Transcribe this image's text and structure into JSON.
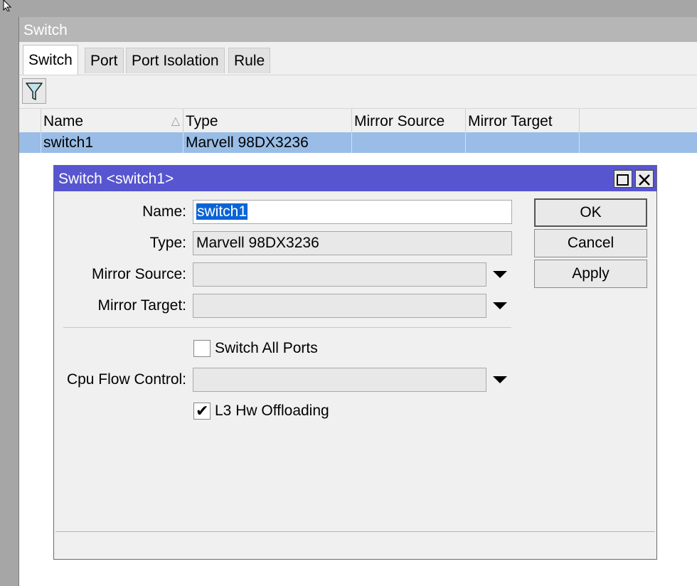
{
  "window": {
    "title": "Switch"
  },
  "tabs": [
    "Switch",
    "Port",
    "Port Isolation",
    "Rule"
  ],
  "icons": {
    "filter": "filter-icon",
    "cursor": "arrow-cursor-icon",
    "maximize": "maximize-icon",
    "close": "close-icon",
    "dropdown": "chevron-down-icon",
    "sort": "sort-ascending-icon"
  },
  "table": {
    "columns": [
      "Name",
      "Type",
      "Mirror Source",
      "Mirror Target"
    ],
    "rows": [
      {
        "name": "switch1",
        "type": "Marvell 98DX3236",
        "mirror_source": "",
        "mirror_target": ""
      }
    ]
  },
  "dialog": {
    "title": "Switch <switch1>",
    "name_label": "Name:",
    "name_value": "switch1",
    "type_label": "Type:",
    "type_value": "Marvell 98DX3236",
    "mirror_source_label": "Mirror Source:",
    "mirror_source_value": "",
    "mirror_target_label": "Mirror Target:",
    "mirror_target_value": "",
    "switch_all_ports_label": "Switch All Ports",
    "switch_all_ports_checked": false,
    "cpu_flow_control_label": "Cpu Flow Control:",
    "cpu_flow_control_value": "",
    "l3_hw_offloading_label": "L3 Hw Offloading",
    "l3_hw_offloading_checked": true,
    "buttons": {
      "ok": "OK",
      "cancel": "Cancel",
      "apply": "Apply"
    }
  }
}
